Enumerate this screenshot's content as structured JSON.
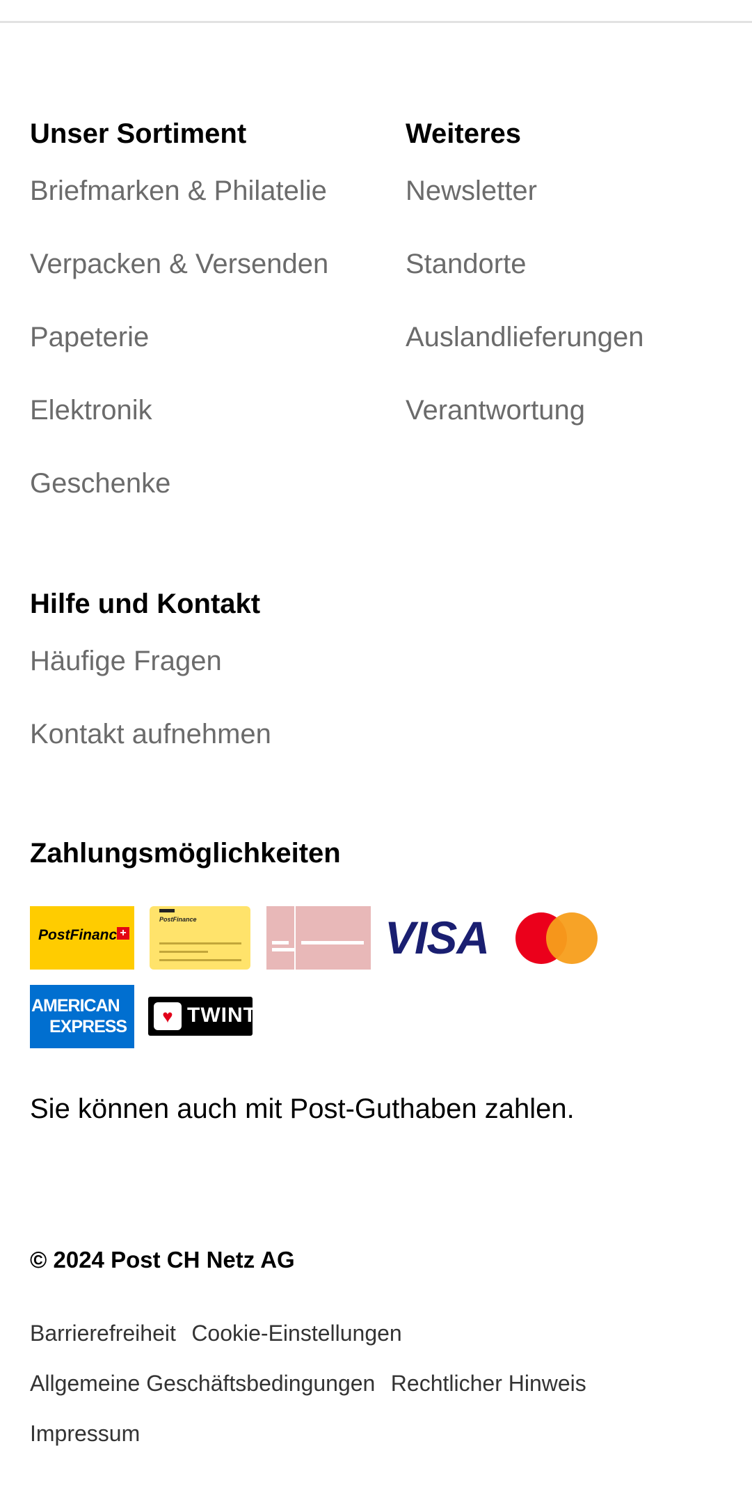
{
  "footer": {
    "sortiment": {
      "heading": "Unser Sortiment",
      "links": [
        "Briefmarken & Philatelie",
        "Verpacken & Versenden",
        "Papeterie",
        "Elektronik",
        "Geschenke"
      ]
    },
    "weiteres": {
      "heading": "Weiteres",
      "links": [
        "Newsletter",
        "Standorte",
        "Auslandlieferungen",
        "Verantwortung"
      ]
    },
    "hilfe": {
      "heading": "Hilfe und Kontakt",
      "links": [
        "Häufige Fragen",
        "Kontakt aufnehmen"
      ]
    },
    "payment": {
      "heading": "Zahlungsmöglichkeiten",
      "logos": {
        "postfinance": {
          "text": "PostFinance",
          "icon": "postfinance-logo",
          "color": "#ffcc00"
        },
        "postfinance_card": {
          "text": "PostFinance",
          "icon": "postfinance-card-logo",
          "color": "#ffe36b"
        },
        "invoice": {
          "icon": "invoice-logo",
          "color": "#e8b8b8"
        },
        "visa": {
          "text": "VISA",
          "icon": "visa-logo",
          "color": "#1a1f71"
        },
        "mastercard": {
          "icon": "mastercard-logo"
        },
        "amex": {
          "line1": "AMERICAN",
          "line2": "EXPRESS",
          "icon": "amex-logo",
          "color": "#016fd0"
        },
        "twint": {
          "text": "TWINT",
          "icon": "twint-logo"
        }
      },
      "note": "Sie können auch mit Post-Guthaben zahlen."
    },
    "copyright": "© 2024 Post CH Netz AG",
    "legal_links": [
      "Barrierefreiheit",
      "Cookie-Einstellungen",
      "Allgemeine Geschäftsbedingungen",
      "Rechtlicher Hinweis",
      "Impressum"
    ]
  }
}
